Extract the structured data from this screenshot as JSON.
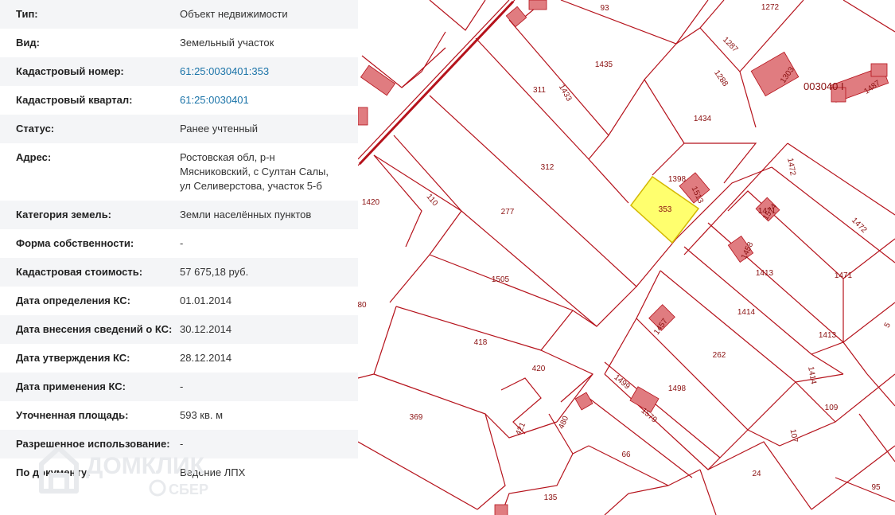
{
  "info": {
    "rows": [
      {
        "label": "Тип:",
        "value": "Объект недвижимости",
        "link": false
      },
      {
        "label": "Вид:",
        "value": "Земельный участок",
        "link": false
      },
      {
        "label": "Кадастровый номер:",
        "value": "61:25:0030401:353",
        "link": true
      },
      {
        "label": "Кадастровый квартал:",
        "value": "61:25:0030401",
        "link": true
      },
      {
        "label": "Статус:",
        "value": "Ранее учтенный",
        "link": false
      },
      {
        "label": "Адрес:",
        "value": "Ростовская обл, р-н Мясниковский, с Султан Салы, ул Селиверстова, участок 5-б",
        "link": false
      },
      {
        "label": "Категория земель:",
        "value": "Земли населённых пунктов",
        "link": false
      },
      {
        "label": "Форма собственности:",
        "value": "-",
        "link": false
      },
      {
        "label": "Кадастровая стоимость:",
        "value": "57 675,18 руб.",
        "link": false
      },
      {
        "label": "Дата определения КС:",
        "value": "01.01.2014",
        "link": false
      },
      {
        "label": "Дата внесения сведений о КС:",
        "value": "30.12.2014",
        "link": false
      },
      {
        "label": "Дата утверждения КС:",
        "value": "28.12.2014",
        "link": false
      },
      {
        "label": "Дата применения КС:",
        "value": "-",
        "link": false
      },
      {
        "label": "Уточненная площадь:",
        "value": "593 кв. м",
        "link": false
      },
      {
        "label": "Разрешенное использование:",
        "value": "-",
        "link": false
      },
      {
        "label": "По документу:",
        "value": "Ведение ЛПХ",
        "link": false
      }
    ]
  },
  "watermark": {
    "brand": "ДОМКЛИК",
    "sub": "СБЕР"
  },
  "map": {
    "quarter_label": "003040 I",
    "selected_parcel": "353",
    "colors": {
      "boundary": "#b5121b",
      "building": "#e07c80",
      "selected": "#ffff6e",
      "link": "#1a73a8"
    },
    "parcel_labels": [
      {
        "id": "p93",
        "text": "93"
      },
      {
        "id": "p1272",
        "text": "1272"
      },
      {
        "id": "p1287",
        "text": "1287"
      },
      {
        "id": "p1303",
        "text": "1303"
      },
      {
        "id": "p1487",
        "text": "1487"
      },
      {
        "id": "p1435",
        "text": "1435"
      },
      {
        "id": "p1288",
        "text": "1288"
      },
      {
        "id": "p311",
        "text": "311"
      },
      {
        "id": "p1433",
        "text": "1433"
      },
      {
        "id": "p1434",
        "text": "1434"
      },
      {
        "id": "p312",
        "text": "312"
      },
      {
        "id": "p1398",
        "text": "1398"
      },
      {
        "id": "p1513",
        "text": "1513"
      },
      {
        "id": "p353",
        "text": "353"
      },
      {
        "id": "p1472a",
        "text": "1472"
      },
      {
        "id": "p1471a",
        "text": "1471"
      },
      {
        "id": "p1574",
        "text": "1574"
      },
      {
        "id": "p1472b",
        "text": "1472"
      },
      {
        "id": "p1420",
        "text": "1420"
      },
      {
        "id": "p110",
        "text": "110"
      },
      {
        "id": "p277",
        "text": "277"
      },
      {
        "id": "p1458",
        "text": "1458"
      },
      {
        "id": "p1413a",
        "text": "1413"
      },
      {
        "id": "p1471b",
        "text": "1471"
      },
      {
        "id": "p1505",
        "text": "1505"
      },
      {
        "id": "p80",
        "text": "80"
      },
      {
        "id": "p1414a",
        "text": "1414"
      },
      {
        "id": "p1413b",
        "text": "1413"
      },
      {
        "id": "p1457",
        "text": "1457"
      },
      {
        "id": "p418",
        "text": "418"
      },
      {
        "id": "p262",
        "text": "262"
      },
      {
        "id": "p420",
        "text": "420"
      },
      {
        "id": "p1414b",
        "text": "1414"
      },
      {
        "id": "p1499",
        "text": "1499"
      },
      {
        "id": "p1498",
        "text": "1498"
      },
      {
        "id": "p369",
        "text": "369"
      },
      {
        "id": "p1579",
        "text": "1579"
      },
      {
        "id": "p480",
        "text": "480"
      },
      {
        "id": "p421",
        "text": "421"
      },
      {
        "id": "p109",
        "text": "109"
      },
      {
        "id": "p107",
        "text": "107"
      },
      {
        "id": "p66",
        "text": "66"
      },
      {
        "id": "p24",
        "text": "24"
      },
      {
        "id": "p135",
        "text": "135"
      },
      {
        "id": "p95",
        "text": "95"
      },
      {
        "id": "p5",
        "text": "5"
      }
    ]
  }
}
